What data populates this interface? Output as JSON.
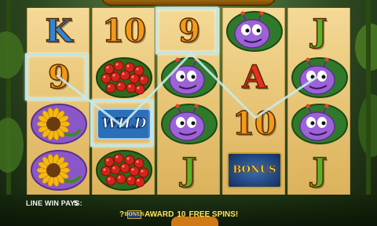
{
  "game": {
    "title_fragment": ""
  },
  "reels": [
    [
      {
        "type": "card",
        "text": "K",
        "color": "#2f86d6"
      },
      {
        "type": "card",
        "text": "9",
        "color": "#f29a1a",
        "highlighted": true
      },
      {
        "type": "symbol",
        "icon": "sunflower-icon"
      },
      {
        "type": "symbol",
        "icon": "sunflower-icon"
      }
    ],
    [
      {
        "type": "card",
        "text": "10",
        "color": "#f29a1a"
      },
      {
        "type": "symbol",
        "icon": "ladybugs-icon"
      },
      {
        "type": "wild",
        "text": "WILD",
        "highlighted": true
      },
      {
        "type": "symbol",
        "icon": "ladybugs-icon"
      }
    ],
    [
      {
        "type": "card",
        "text": "9",
        "color": "#f29a1a",
        "highlighted": true
      },
      {
        "type": "symbol",
        "icon": "bug-character-icon"
      },
      {
        "type": "symbol",
        "icon": "bug-character-icon"
      },
      {
        "type": "card",
        "text": "J",
        "color": "#57b22a"
      }
    ],
    [
      {
        "type": "symbol",
        "icon": "bug-character-icon"
      },
      {
        "type": "card",
        "text": "A",
        "color": "#e83020"
      },
      {
        "type": "card",
        "text": "10",
        "color": "#f29a1a"
      },
      {
        "type": "bonus",
        "text": "BONUS"
      }
    ],
    [
      {
        "type": "card",
        "text": "J",
        "color": "#57b22a"
      },
      {
        "type": "symbol",
        "icon": "bug-character-icon"
      },
      {
        "type": "symbol",
        "icon": "bug-character-icon"
      },
      {
        "type": "card",
        "text": "J",
        "color": "#57b22a"
      }
    ]
  ],
  "status": {
    "line_win_label": "LINE WIN PAYS:",
    "line_win_value": "5",
    "award_prefix": "?",
    "award_text": "AWARD",
    "award_number": "10",
    "award_suffix": "FREE SPINS!",
    "bonus_icon_text": "BONUS"
  },
  "colors": {
    "reel_bg": "#f0d084",
    "highlight": "#bfe6e8",
    "award_text": "#ffe25a"
  }
}
